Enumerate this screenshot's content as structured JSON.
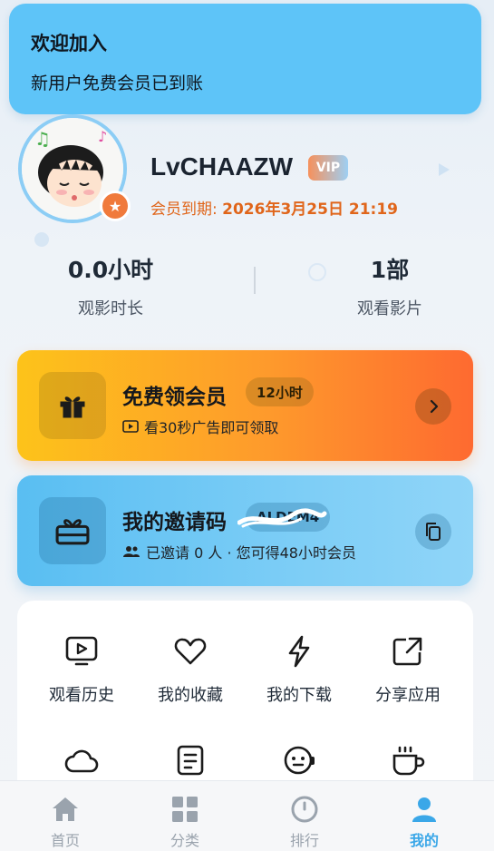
{
  "toast": {
    "title": "欢迎加入",
    "message": "新用户免费会员已到账"
  },
  "profile": {
    "username": "LvCHAAZW",
    "vip_label": "VIP",
    "expiry_label": "会员到期: ",
    "expiry_value": "2026年3月25日 21:19",
    "avatar_icon": "cartoon-avatar",
    "badge_icon": "star-icon"
  },
  "stats": [
    {
      "value": "0.0小时",
      "label": "观影时长"
    },
    {
      "value": "1部",
      "label": "观看影片"
    }
  ],
  "free_vip_card": {
    "title": "免费领会员",
    "pill": "12小时",
    "subtitle": "看30秒广告即可领取",
    "icon": "gift-icon",
    "sub_icon": "video-icon",
    "action_icon": "chevron-right-icon",
    "colors": {
      "start": "#fdc31a",
      "end": "#fe6a30"
    }
  },
  "invite_card": {
    "title": "我的邀请码",
    "code": "ALDEM4",
    "subtitle": "已邀请 0 人 · 您可得48小时会员",
    "icon": "gift-box-icon",
    "sub_icon": "people-icon",
    "action_icon": "copy-icon",
    "colors": {
      "start": "#59bef2",
      "end": "#90d5f8"
    }
  },
  "grid": [
    {
      "label": "观看历史",
      "icon": "history-icon"
    },
    {
      "label": "我的收藏",
      "icon": "heart-icon"
    },
    {
      "label": "我的下载",
      "icon": "download-icon"
    },
    {
      "label": "分享应用",
      "icon": "share-icon"
    },
    {
      "label": "",
      "icon": "cloud-icon"
    },
    {
      "label": "",
      "icon": "note-icon"
    },
    {
      "label": "",
      "icon": "support-icon"
    },
    {
      "label": "",
      "icon": "coffee-icon"
    }
  ],
  "bottom_nav": [
    {
      "label": "首页",
      "icon": "home-icon",
      "active": false
    },
    {
      "label": "分类",
      "icon": "category-icon",
      "active": false
    },
    {
      "label": "排行",
      "icon": "ranking-icon",
      "active": false
    },
    {
      "label": "我的",
      "icon": "profile-icon",
      "active": true
    }
  ],
  "accent_color": "#3aa7e8"
}
